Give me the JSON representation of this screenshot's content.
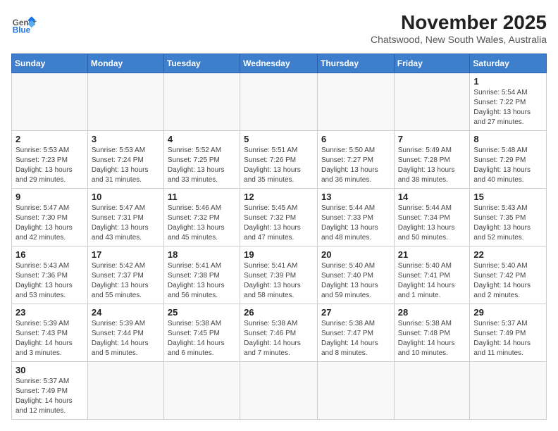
{
  "header": {
    "logo_general": "General",
    "logo_blue": "Blue",
    "month_title": "November 2025",
    "location": "Chatswood, New South Wales, Australia"
  },
  "weekdays": [
    "Sunday",
    "Monday",
    "Tuesday",
    "Wednesday",
    "Thursday",
    "Friday",
    "Saturday"
  ],
  "weeks": [
    [
      {
        "day": "",
        "info": ""
      },
      {
        "day": "",
        "info": ""
      },
      {
        "day": "",
        "info": ""
      },
      {
        "day": "",
        "info": ""
      },
      {
        "day": "",
        "info": ""
      },
      {
        "day": "",
        "info": ""
      },
      {
        "day": "1",
        "info": "Sunrise: 5:54 AM\nSunset: 7:22 PM\nDaylight: 13 hours\nand 27 minutes."
      }
    ],
    [
      {
        "day": "2",
        "info": "Sunrise: 5:53 AM\nSunset: 7:23 PM\nDaylight: 13 hours\nand 29 minutes."
      },
      {
        "day": "3",
        "info": "Sunrise: 5:53 AM\nSunset: 7:24 PM\nDaylight: 13 hours\nand 31 minutes."
      },
      {
        "day": "4",
        "info": "Sunrise: 5:52 AM\nSunset: 7:25 PM\nDaylight: 13 hours\nand 33 minutes."
      },
      {
        "day": "5",
        "info": "Sunrise: 5:51 AM\nSunset: 7:26 PM\nDaylight: 13 hours\nand 35 minutes."
      },
      {
        "day": "6",
        "info": "Sunrise: 5:50 AM\nSunset: 7:27 PM\nDaylight: 13 hours\nand 36 minutes."
      },
      {
        "day": "7",
        "info": "Sunrise: 5:49 AM\nSunset: 7:28 PM\nDaylight: 13 hours\nand 38 minutes."
      },
      {
        "day": "8",
        "info": "Sunrise: 5:48 AM\nSunset: 7:29 PM\nDaylight: 13 hours\nand 40 minutes."
      }
    ],
    [
      {
        "day": "9",
        "info": "Sunrise: 5:47 AM\nSunset: 7:30 PM\nDaylight: 13 hours\nand 42 minutes."
      },
      {
        "day": "10",
        "info": "Sunrise: 5:47 AM\nSunset: 7:31 PM\nDaylight: 13 hours\nand 43 minutes."
      },
      {
        "day": "11",
        "info": "Sunrise: 5:46 AM\nSunset: 7:32 PM\nDaylight: 13 hours\nand 45 minutes."
      },
      {
        "day": "12",
        "info": "Sunrise: 5:45 AM\nSunset: 7:32 PM\nDaylight: 13 hours\nand 47 minutes."
      },
      {
        "day": "13",
        "info": "Sunrise: 5:44 AM\nSunset: 7:33 PM\nDaylight: 13 hours\nand 48 minutes."
      },
      {
        "day": "14",
        "info": "Sunrise: 5:44 AM\nSunset: 7:34 PM\nDaylight: 13 hours\nand 50 minutes."
      },
      {
        "day": "15",
        "info": "Sunrise: 5:43 AM\nSunset: 7:35 PM\nDaylight: 13 hours\nand 52 minutes."
      }
    ],
    [
      {
        "day": "16",
        "info": "Sunrise: 5:43 AM\nSunset: 7:36 PM\nDaylight: 13 hours\nand 53 minutes."
      },
      {
        "day": "17",
        "info": "Sunrise: 5:42 AM\nSunset: 7:37 PM\nDaylight: 13 hours\nand 55 minutes."
      },
      {
        "day": "18",
        "info": "Sunrise: 5:41 AM\nSunset: 7:38 PM\nDaylight: 13 hours\nand 56 minutes."
      },
      {
        "day": "19",
        "info": "Sunrise: 5:41 AM\nSunset: 7:39 PM\nDaylight: 13 hours\nand 58 minutes."
      },
      {
        "day": "20",
        "info": "Sunrise: 5:40 AM\nSunset: 7:40 PM\nDaylight: 13 hours\nand 59 minutes."
      },
      {
        "day": "21",
        "info": "Sunrise: 5:40 AM\nSunset: 7:41 PM\nDaylight: 14 hours\nand 1 minute."
      },
      {
        "day": "22",
        "info": "Sunrise: 5:40 AM\nSunset: 7:42 PM\nDaylight: 14 hours\nand 2 minutes."
      }
    ],
    [
      {
        "day": "23",
        "info": "Sunrise: 5:39 AM\nSunset: 7:43 PM\nDaylight: 14 hours\nand 3 minutes."
      },
      {
        "day": "24",
        "info": "Sunrise: 5:39 AM\nSunset: 7:44 PM\nDaylight: 14 hours\nand 5 minutes."
      },
      {
        "day": "25",
        "info": "Sunrise: 5:38 AM\nSunset: 7:45 PM\nDaylight: 14 hours\nand 6 minutes."
      },
      {
        "day": "26",
        "info": "Sunrise: 5:38 AM\nSunset: 7:46 PM\nDaylight: 14 hours\nand 7 minutes."
      },
      {
        "day": "27",
        "info": "Sunrise: 5:38 AM\nSunset: 7:47 PM\nDaylight: 14 hours\nand 8 minutes."
      },
      {
        "day": "28",
        "info": "Sunrise: 5:38 AM\nSunset: 7:48 PM\nDaylight: 14 hours\nand 10 minutes."
      },
      {
        "day": "29",
        "info": "Sunrise: 5:37 AM\nSunset: 7:49 PM\nDaylight: 14 hours\nand 11 minutes."
      }
    ],
    [
      {
        "day": "30",
        "info": "Sunrise: 5:37 AM\nSunset: 7:49 PM\nDaylight: 14 hours\nand 12 minutes."
      },
      {
        "day": "",
        "info": ""
      },
      {
        "day": "",
        "info": ""
      },
      {
        "day": "",
        "info": ""
      },
      {
        "day": "",
        "info": ""
      },
      {
        "day": "",
        "info": ""
      },
      {
        "day": "",
        "info": ""
      }
    ]
  ]
}
